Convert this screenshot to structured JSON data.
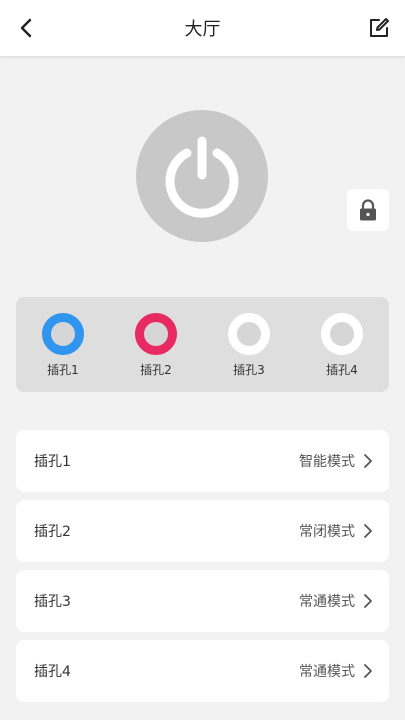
{
  "header": {
    "title": "大厅",
    "back_icon": "chevron-left-icon",
    "edit_icon": "edit-icon"
  },
  "power": {
    "icon": "power-icon"
  },
  "lock": {
    "icon": "lock-icon"
  },
  "sockets": [
    {
      "label": "插孔1",
      "color": "#2f95ee"
    },
    {
      "label": "插孔2",
      "color": "#e82a63"
    },
    {
      "label": "插孔3",
      "color": "#ffffff"
    },
    {
      "label": "插孔4",
      "color": "#ffffff"
    }
  ],
  "list": [
    {
      "name": "插孔1",
      "mode": "智能模式"
    },
    {
      "name": "插孔2",
      "mode": "常闭模式"
    },
    {
      "name": "插孔3",
      "mode": "常通模式"
    },
    {
      "name": "插孔4",
      "mode": "常通模式"
    }
  ]
}
